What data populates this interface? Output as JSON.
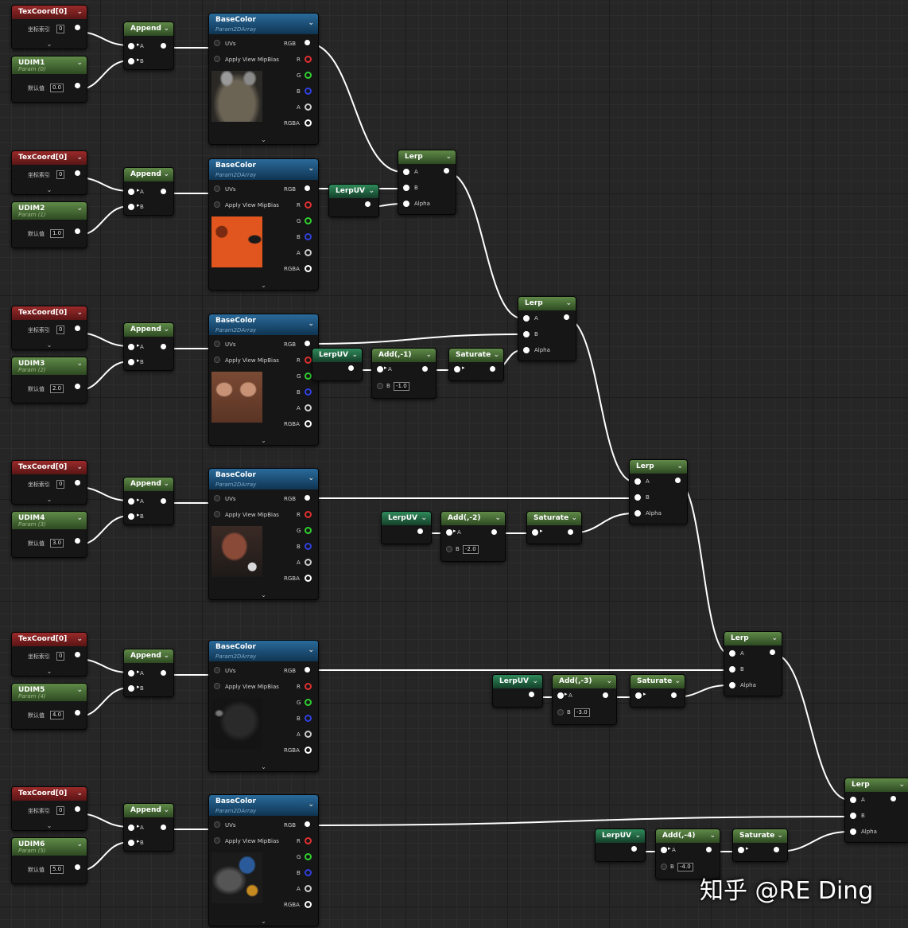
{
  "labels": {
    "texcoord_title": "TexCoord[0]",
    "coord_index": "坐标索引",
    "coord_value": "0",
    "append_title": "Append",
    "pin_a": "A",
    "pin_b": "B",
    "alpha": "Alpha",
    "default_value": "默认值",
    "base_color_title": "BaseColor",
    "base_color_sub": "Param2DArray",
    "uvs": "UVs",
    "apply_mip": "Apply View MipBias",
    "rgb": "RGB",
    "r": "R",
    "g": "G",
    "b": "B",
    "a": "A",
    "rgba": "RGBA",
    "lerp_title": "Lerp",
    "lerpuv_title": "LerpUV",
    "saturate_title": "Saturate",
    "collapse_arrow": "⌄"
  },
  "rows": [
    {
      "udim_title": "UDIM1",
      "udim_sub": "Param (0)",
      "udim_value": "0.0",
      "thumb": "dark-grey-atlas"
    },
    {
      "udim_title": "UDIM2",
      "udim_sub": "Param (1)",
      "udim_value": "1.0",
      "thumb": "orange-atlas"
    },
    {
      "udim_title": "UDIM3",
      "udim_sub": "Param (2)",
      "udim_value": "2.0",
      "thumb": "brown-atlas",
      "add_title": "Add(,-1)",
      "add_value": "-1.0"
    },
    {
      "udim_title": "UDIM4",
      "udim_sub": "Param (3)",
      "udim_value": "3.0",
      "thumb": "face-atlas",
      "add_title": "Add(,-2)",
      "add_value": "-2.0"
    },
    {
      "udim_title": "UDIM5",
      "udim_sub": "Param (4)",
      "udim_value": "4.0",
      "thumb": "black-atlas",
      "add_title": "Add(,-3)",
      "add_value": "-3.0"
    },
    {
      "udim_title": "UDIM6",
      "udim_sub": "Param (5)",
      "udim_value": "5.0",
      "thumb": "blue-gear-atlas",
      "add_title": "Add(,-4)",
      "add_value": "-4.0"
    }
  ],
  "watermark": "知乎 @RE Ding",
  "colors": {
    "graph_bg": "#262626",
    "wire": "#ffffff",
    "texcoord_header": "#9a2a2a",
    "param_header": "#5f8a48",
    "texture_header": "#2a6a9a",
    "lerpuv_header": "#2f8a5a"
  }
}
